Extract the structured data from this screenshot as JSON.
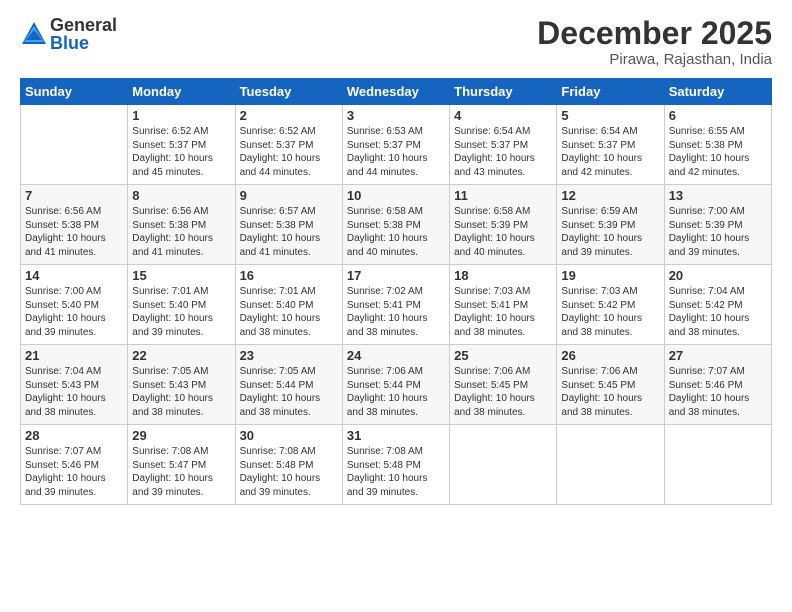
{
  "logo": {
    "general": "General",
    "blue": "Blue"
  },
  "title": "December 2025",
  "location": "Pirawa, Rajasthan, India",
  "days": [
    "Sunday",
    "Monday",
    "Tuesday",
    "Wednesday",
    "Thursday",
    "Friday",
    "Saturday"
  ],
  "weeks": [
    [
      {
        "day": "",
        "sunrise": "",
        "sunset": "",
        "daylight": ""
      },
      {
        "day": "1",
        "sunrise": "Sunrise: 6:52 AM",
        "sunset": "Sunset: 5:37 PM",
        "daylight": "Daylight: 10 hours and 45 minutes."
      },
      {
        "day": "2",
        "sunrise": "Sunrise: 6:52 AM",
        "sunset": "Sunset: 5:37 PM",
        "daylight": "Daylight: 10 hours and 44 minutes."
      },
      {
        "day": "3",
        "sunrise": "Sunrise: 6:53 AM",
        "sunset": "Sunset: 5:37 PM",
        "daylight": "Daylight: 10 hours and 44 minutes."
      },
      {
        "day": "4",
        "sunrise": "Sunrise: 6:54 AM",
        "sunset": "Sunset: 5:37 PM",
        "daylight": "Daylight: 10 hours and 43 minutes."
      },
      {
        "day": "5",
        "sunrise": "Sunrise: 6:54 AM",
        "sunset": "Sunset: 5:37 PM",
        "daylight": "Daylight: 10 hours and 42 minutes."
      },
      {
        "day": "6",
        "sunrise": "Sunrise: 6:55 AM",
        "sunset": "Sunset: 5:38 PM",
        "daylight": "Daylight: 10 hours and 42 minutes."
      }
    ],
    [
      {
        "day": "7",
        "sunrise": "Sunrise: 6:56 AM",
        "sunset": "Sunset: 5:38 PM",
        "daylight": "Daylight: 10 hours and 41 minutes."
      },
      {
        "day": "8",
        "sunrise": "Sunrise: 6:56 AM",
        "sunset": "Sunset: 5:38 PM",
        "daylight": "Daylight: 10 hours and 41 minutes."
      },
      {
        "day": "9",
        "sunrise": "Sunrise: 6:57 AM",
        "sunset": "Sunset: 5:38 PM",
        "daylight": "Daylight: 10 hours and 41 minutes."
      },
      {
        "day": "10",
        "sunrise": "Sunrise: 6:58 AM",
        "sunset": "Sunset: 5:38 PM",
        "daylight": "Daylight: 10 hours and 40 minutes."
      },
      {
        "day": "11",
        "sunrise": "Sunrise: 6:58 AM",
        "sunset": "Sunset: 5:39 PM",
        "daylight": "Daylight: 10 hours and 40 minutes."
      },
      {
        "day": "12",
        "sunrise": "Sunrise: 6:59 AM",
        "sunset": "Sunset: 5:39 PM",
        "daylight": "Daylight: 10 hours and 39 minutes."
      },
      {
        "day": "13",
        "sunrise": "Sunrise: 7:00 AM",
        "sunset": "Sunset: 5:39 PM",
        "daylight": "Daylight: 10 hours and 39 minutes."
      }
    ],
    [
      {
        "day": "14",
        "sunrise": "Sunrise: 7:00 AM",
        "sunset": "Sunset: 5:40 PM",
        "daylight": "Daylight: 10 hours and 39 minutes."
      },
      {
        "day": "15",
        "sunrise": "Sunrise: 7:01 AM",
        "sunset": "Sunset: 5:40 PM",
        "daylight": "Daylight: 10 hours and 39 minutes."
      },
      {
        "day": "16",
        "sunrise": "Sunrise: 7:01 AM",
        "sunset": "Sunset: 5:40 PM",
        "daylight": "Daylight: 10 hours and 38 minutes."
      },
      {
        "day": "17",
        "sunrise": "Sunrise: 7:02 AM",
        "sunset": "Sunset: 5:41 PM",
        "daylight": "Daylight: 10 hours and 38 minutes."
      },
      {
        "day": "18",
        "sunrise": "Sunrise: 7:03 AM",
        "sunset": "Sunset: 5:41 PM",
        "daylight": "Daylight: 10 hours and 38 minutes."
      },
      {
        "day": "19",
        "sunrise": "Sunrise: 7:03 AM",
        "sunset": "Sunset: 5:42 PM",
        "daylight": "Daylight: 10 hours and 38 minutes."
      },
      {
        "day": "20",
        "sunrise": "Sunrise: 7:04 AM",
        "sunset": "Sunset: 5:42 PM",
        "daylight": "Daylight: 10 hours and 38 minutes."
      }
    ],
    [
      {
        "day": "21",
        "sunrise": "Sunrise: 7:04 AM",
        "sunset": "Sunset: 5:43 PM",
        "daylight": "Daylight: 10 hours and 38 minutes."
      },
      {
        "day": "22",
        "sunrise": "Sunrise: 7:05 AM",
        "sunset": "Sunset: 5:43 PM",
        "daylight": "Daylight: 10 hours and 38 minutes."
      },
      {
        "day": "23",
        "sunrise": "Sunrise: 7:05 AM",
        "sunset": "Sunset: 5:44 PM",
        "daylight": "Daylight: 10 hours and 38 minutes."
      },
      {
        "day": "24",
        "sunrise": "Sunrise: 7:06 AM",
        "sunset": "Sunset: 5:44 PM",
        "daylight": "Daylight: 10 hours and 38 minutes."
      },
      {
        "day": "25",
        "sunrise": "Sunrise: 7:06 AM",
        "sunset": "Sunset: 5:45 PM",
        "daylight": "Daylight: 10 hours and 38 minutes."
      },
      {
        "day": "26",
        "sunrise": "Sunrise: 7:06 AM",
        "sunset": "Sunset: 5:45 PM",
        "daylight": "Daylight: 10 hours and 38 minutes."
      },
      {
        "day": "27",
        "sunrise": "Sunrise: 7:07 AM",
        "sunset": "Sunset: 5:46 PM",
        "daylight": "Daylight: 10 hours and 38 minutes."
      }
    ],
    [
      {
        "day": "28",
        "sunrise": "Sunrise: 7:07 AM",
        "sunset": "Sunset: 5:46 PM",
        "daylight": "Daylight: 10 hours and 39 minutes."
      },
      {
        "day": "29",
        "sunrise": "Sunrise: 7:08 AM",
        "sunset": "Sunset: 5:47 PM",
        "daylight": "Daylight: 10 hours and 39 minutes."
      },
      {
        "day": "30",
        "sunrise": "Sunrise: 7:08 AM",
        "sunset": "Sunset: 5:48 PM",
        "daylight": "Daylight: 10 hours and 39 minutes."
      },
      {
        "day": "31",
        "sunrise": "Sunrise: 7:08 AM",
        "sunset": "Sunset: 5:48 PM",
        "daylight": "Daylight: 10 hours and 39 minutes."
      },
      {
        "day": "",
        "sunrise": "",
        "sunset": "",
        "daylight": ""
      },
      {
        "day": "",
        "sunrise": "",
        "sunset": "",
        "daylight": ""
      },
      {
        "day": "",
        "sunrise": "",
        "sunset": "",
        "daylight": ""
      }
    ]
  ]
}
